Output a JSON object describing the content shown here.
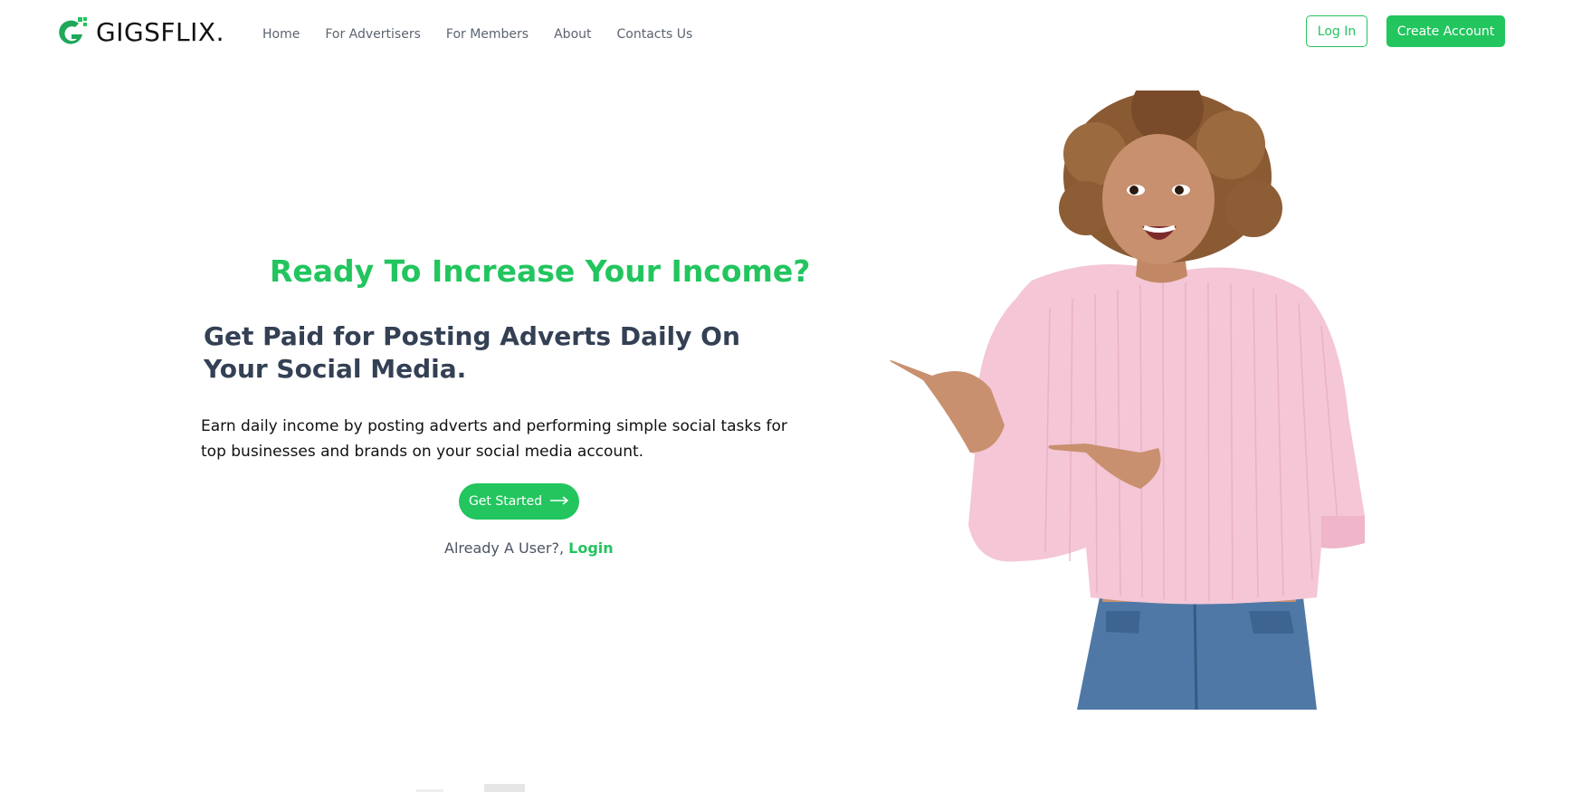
{
  "brand": {
    "name": "GIGSFLIX.",
    "accent_color": "#22c55e"
  },
  "nav": {
    "items": [
      {
        "label": "Home"
      },
      {
        "label": "For Advertisers"
      },
      {
        "label": "For Members"
      },
      {
        "label": "About"
      },
      {
        "label": "Contacts Us"
      }
    ]
  },
  "header": {
    "login_label": "Log In",
    "create_account_label": "Create Account"
  },
  "hero": {
    "title": "Ready To Increase Your Income?",
    "subtitle": "Get Paid for Posting Adverts Daily On Your Social Media.",
    "description": "Earn daily income by posting adverts and performing simple social tasks for top businesses and brands on your social media account.",
    "cta_label": "Get Started",
    "cta_icon": "arrow-right-icon",
    "already_text": "Already A User?,",
    "login_link": "Login"
  },
  "hero_image": {
    "subject": "woman-pointing-photo"
  }
}
